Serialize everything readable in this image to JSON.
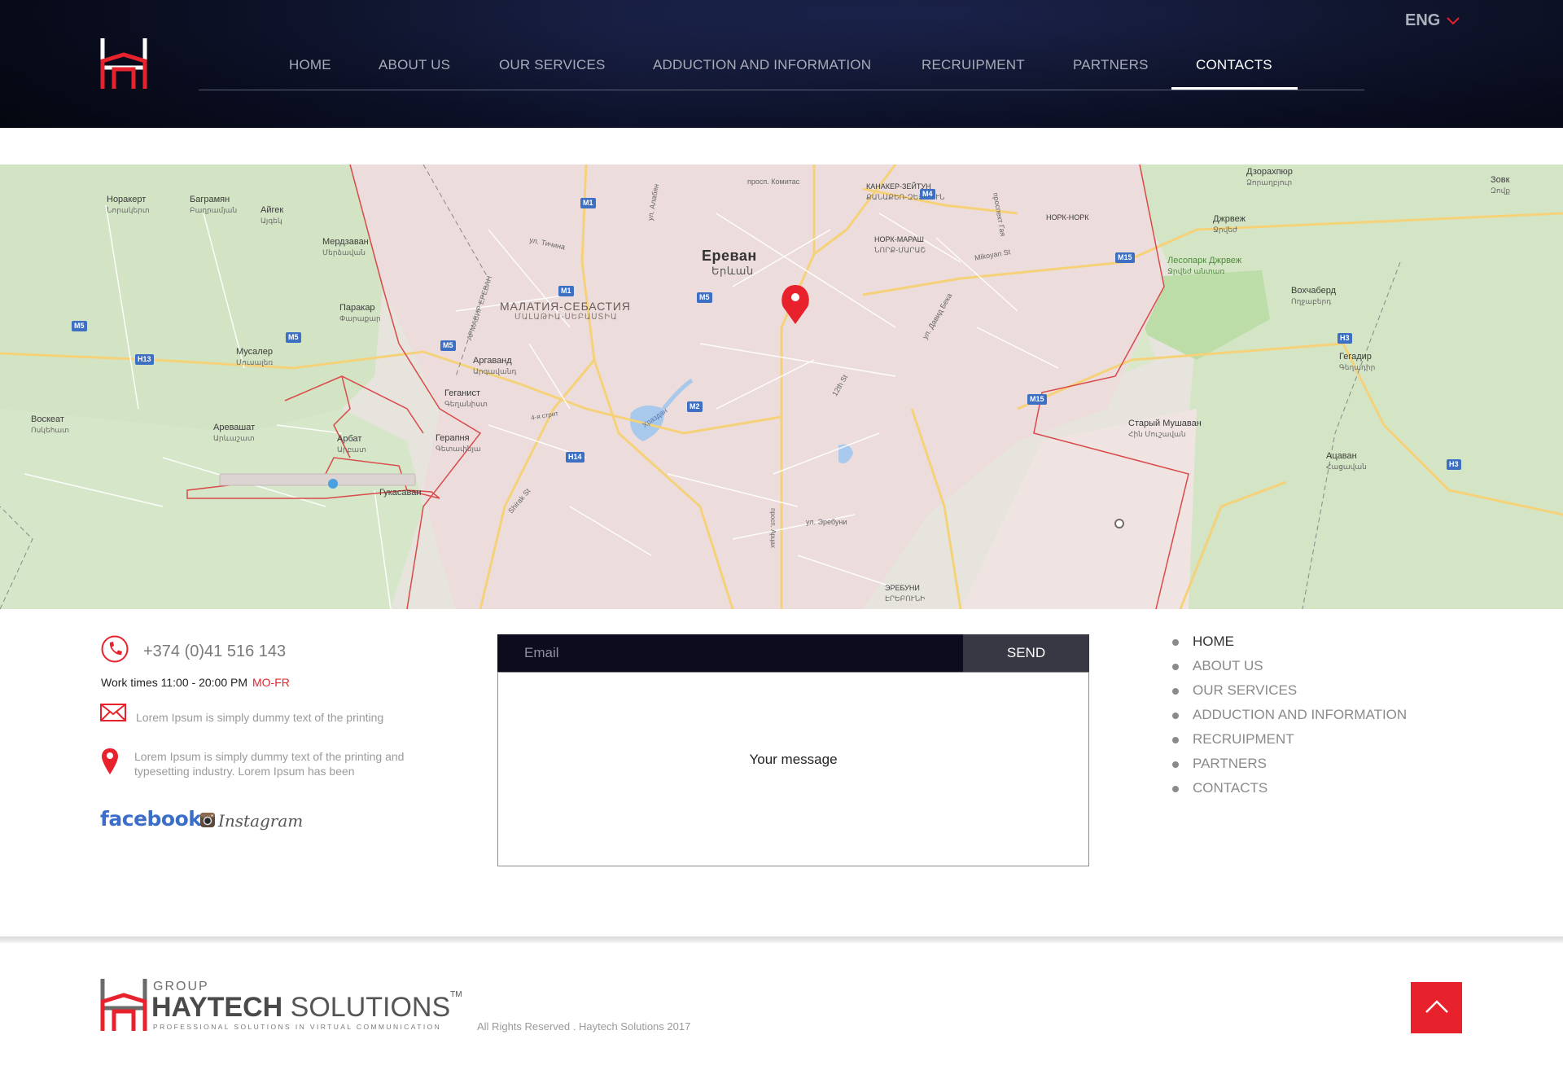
{
  "header": {
    "lang": "ENG",
    "nav": [
      {
        "label": "HOME",
        "active": false
      },
      {
        "label": "ABOUT US",
        "active": false
      },
      {
        "label": "OUR SERVICES",
        "active": false
      },
      {
        "label": "ADDUCTION AND INFORMATION",
        "active": false
      },
      {
        "label": "RECRUIPMENT",
        "active": false
      },
      {
        "label": "PARTNERS",
        "active": false
      },
      {
        "label": "CONTACTS",
        "active": true
      }
    ]
  },
  "map": {
    "city": "Ереван",
    "city_arm": "Երևան",
    "district": "МАЛАТИЯ-СЕБАСТИЯ",
    "district_arm": "ՄԱԼԱԹԻԱ-ՍԵԲԱՍՏԻԱ",
    "labels": [
      {
        "ru": "Норакерт",
        "arm": "Նորակերտ"
      },
      {
        "ru": "Баграмян",
        "arm": "Բաղրամյան"
      },
      {
        "ru": "Айгек",
        "arm": "Այգեկ"
      },
      {
        "ru": "Мердзаван",
        "arm": "Մերձավան"
      },
      {
        "ru": "Паракар",
        "arm": "Փարաքար"
      },
      {
        "ru": "Мусалер",
        "arm": "Մուսալեռ"
      },
      {
        "ru": "Воскеат",
        "arm": "Ոսկեհատ"
      },
      {
        "ru": "Аревашат",
        "arm": "Արևաշատ"
      },
      {
        "ru": "Арбат",
        "arm": "Արբատ"
      },
      {
        "ru": "Гукасаван",
        "arm": ""
      },
      {
        "ru": "Аргаванд",
        "arm": "Արգավանդ"
      },
      {
        "ru": "Геганист",
        "arm": "Գեղանիստ"
      },
      {
        "ru": "Герапня",
        "arm": "Գետափնյա"
      },
      {
        "ru": "Дзорахпюр",
        "arm": "Ձորաղբյուր"
      },
      {
        "ru": "Джрвеж",
        "arm": "Ջրվեժ"
      },
      {
        "ru": "Зовк",
        "arm": "Զովք"
      },
      {
        "ru": "Вохчаберд",
        "arm": "Ողջաբերդ"
      },
      {
        "ru": "Гегадир",
        "arm": "Գեղադիր"
      },
      {
        "ru": "Ацаван",
        "arm": "Հացավան"
      },
      {
        "ru": "Старый Мушаван",
        "arm": "Հին Մուշավան"
      },
      {
        "ru": "Лесопарк Джрвеж",
        "arm": "Ջրվեժ անտառ"
      },
      {
        "ru": "КАНАКЕР-ЗЕЙТУН",
        "arm": "ՔԱՆԱՔԵՌ-ԶԵՅԹՈՒՆ"
      },
      {
        "ru": "НОРК-НОРК",
        "arm": ""
      },
      {
        "ru": "НОРК-МАРАШ",
        "arm": "ՆՈՐՔ-ՄԱՐԱՇ"
      },
      {
        "ru": "ЭРЕБУНИ",
        "arm": "ԷՐԵԲՈՒՆԻ"
      },
      {
        "ru": "просп. Комитас",
        "arm": ""
      },
      {
        "ru": "ул. Тичина",
        "arm": ""
      },
      {
        "ru": "Храздан",
        "arm": ""
      },
      {
        "ru": "ул. Эребуни",
        "arm": ""
      },
      {
        "ru": "Mikoyan St",
        "arm": ""
      },
      {
        "ru": "ул. Давид Бека",
        "arm": ""
      },
      {
        "ru": "Shirak St",
        "arm": ""
      },
      {
        "ru": "12th St",
        "arm": ""
      },
      {
        "ru": "4-я стрит",
        "arm": ""
      },
      {
        "ru": "проспект Гая",
        "arm": ""
      },
      {
        "ru": "просп. Арцах",
        "arm": ""
      },
      {
        "ru": "ул. Алабян",
        "arm": ""
      },
      {
        "ru": "АРМАВИР ЕРЕВАН",
        "arm": ""
      }
    ],
    "shields": [
      "M1",
      "M1",
      "M4",
      "M5",
      "M5",
      "M5",
      "M5",
      "M15",
      "M15",
      "M2",
      "H13",
      "H14",
      "H3",
      "H3"
    ]
  },
  "contact": {
    "phone": "+374 (0)41 516 143",
    "work_times": "Work times 11:00 - 20:00 PM",
    "work_days": "MO-FR",
    "email_text": "Lorem Ipsum is simply dummy text of the printing",
    "address_text": "Lorem Ipsum is simply dummy text of the printing and typesetting industry. Lorem Ipsum has been",
    "facebook": "facebook.",
    "instagram": "Instagram"
  },
  "form": {
    "email_placeholder": "Email",
    "send_label": "SEND",
    "message_placeholder": "Your message"
  },
  "footer_links": [
    "HOME",
    "ABOUT US",
    "OUR SERVICES",
    "ADDUCTION AND INFORMATION",
    "RECRUIPMENT",
    "PARTNERS",
    "CONTACTS"
  ],
  "footer": {
    "brand_group": "GROUP",
    "brand_name_bold": "HAYTECH",
    "brand_name_light": "SOLUTIONS",
    "brand_tm": "TM",
    "brand_tagline": "PROFESSIONAL SOLUTIONS IN VIRTUAL COMMUNICATION",
    "rights": "All Rights Reserved . Haytech Solutions 2017"
  },
  "colors": {
    "accent": "#e8222c",
    "header_dark": "#0b0f24",
    "form_dark": "#0c0c1e",
    "send_bg": "#383844"
  }
}
